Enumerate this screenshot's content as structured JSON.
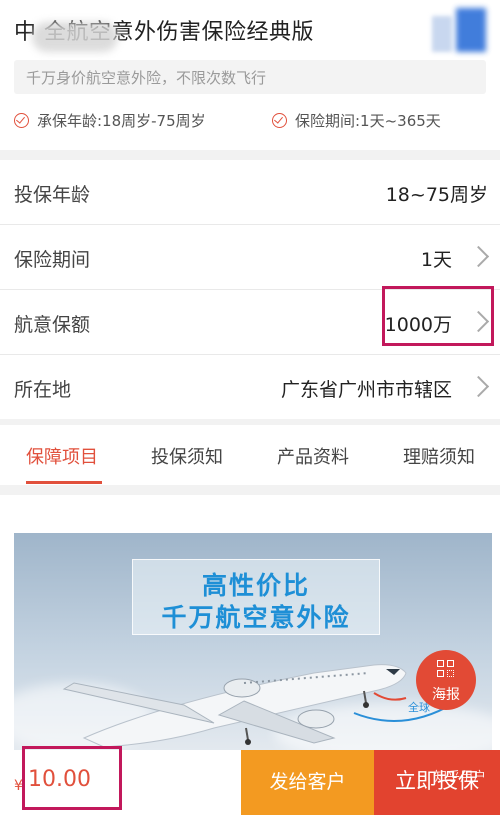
{
  "header": {
    "title": "中        全航空意外伤害保险经典版",
    "subtitle": "千万身价航空意外险，不限次数飞行",
    "features": [
      "承保年龄:18周岁-75周岁",
      "保险期间:1天~365天"
    ]
  },
  "rows": [
    {
      "label": "投保年龄",
      "value": "18~75周岁"
    },
    {
      "label": "保险期间",
      "value": "1天"
    },
    {
      "label": "航意保额",
      "value": "1000万"
    },
    {
      "label": "所在地",
      "value": "广东省广州市市辖区"
    }
  ],
  "tabs": [
    "保障项目",
    "投保须知",
    "产品资料",
    "理赔须知"
  ],
  "banner": {
    "line1": "高性价比",
    "line2": "千万航空意外险",
    "plane_text": "全球"
  },
  "poster_button": "海报",
  "bottom": {
    "currency": "¥",
    "price": "10.00",
    "send_label": "发给客户",
    "buy_label": "立即投保",
    "watermark": "知乎用户"
  },
  "colors": {
    "accent": "#e1503c",
    "orange": "#f39a21",
    "highlight": "#c2185b"
  }
}
